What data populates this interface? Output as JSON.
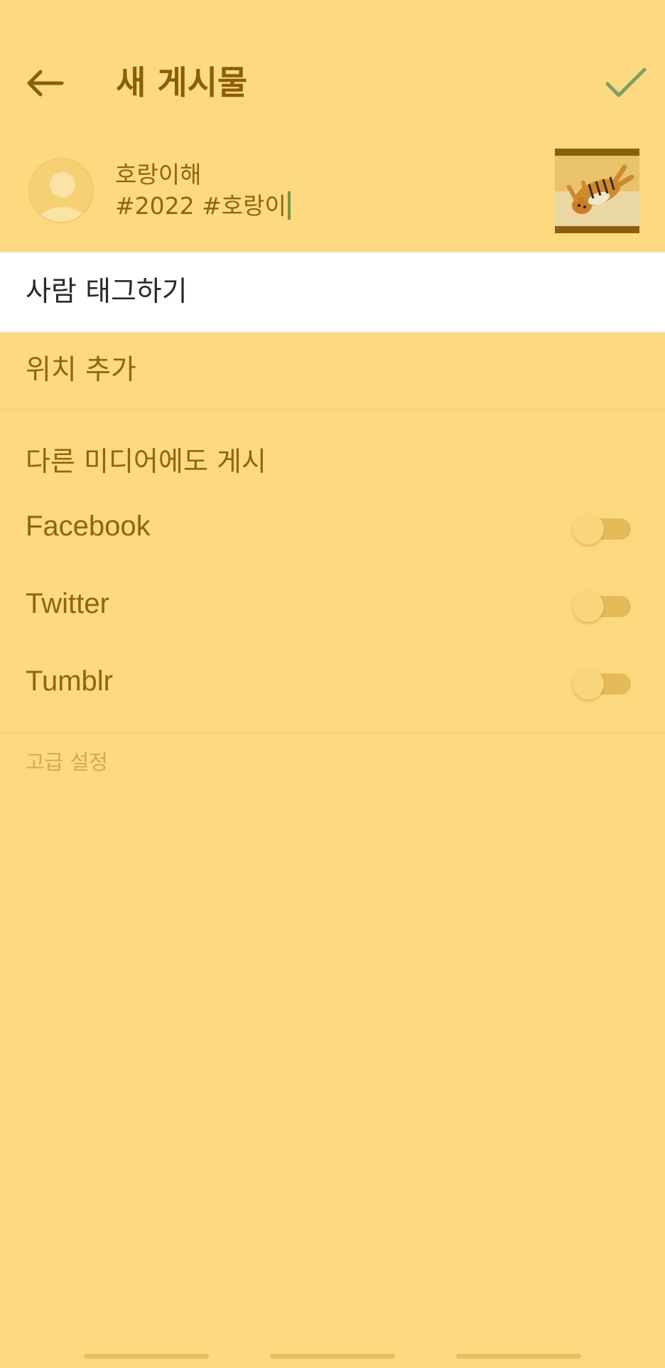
{
  "header": {
    "title": "새 게시물",
    "back_icon": "arrow-left-icon",
    "confirm_icon": "check-icon"
  },
  "composer": {
    "avatar_icon": "default-avatar-icon",
    "caption_lines": [
      "호랑이해",
      "#2022 #호랑이"
    ],
    "thumbnail_icon": "tiger-photo-thumbnail"
  },
  "menu": {
    "tag_people": "사람 태그하기",
    "add_location": "위치 추가"
  },
  "share": {
    "header": "다른 미디어에도 게시",
    "items": [
      {
        "label": "Facebook",
        "enabled": false
      },
      {
        "label": "Twitter",
        "enabled": false
      },
      {
        "label": "Tumblr",
        "enabled": false
      }
    ]
  },
  "advanced_settings": "고급 설정",
  "colors": {
    "background": "#FDD97F",
    "accent_text": "#8A5E0C",
    "check_color": "#7E9E6A",
    "cursor_color": "#7C9444"
  }
}
